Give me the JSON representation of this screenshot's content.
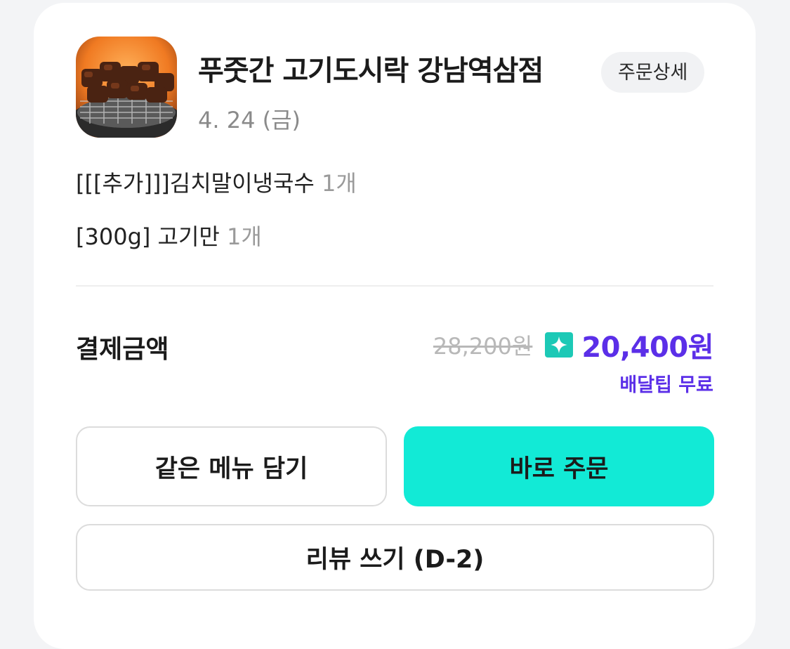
{
  "store": {
    "name": "푸줏간 고기도시락 강남역삼점",
    "order_detail_label": "주문상세",
    "date": "4. 24 (금)",
    "thumbnail_icon": "grilled-meat-photo"
  },
  "menu_items": [
    {
      "name": "[[[추가]]]김치말이냉국수",
      "quantity": "1개"
    },
    {
      "name": "[300g] 고기만",
      "quantity": "1개"
    }
  ],
  "payment": {
    "label": "결제금액",
    "original_price": "28,200원",
    "final_price": "20,400원",
    "delivery_tip": "배달팁 무료",
    "badge_icon": "sparkle-icon"
  },
  "actions": {
    "same_menu_label": "같은 메뉴 담기",
    "order_now_label": "바로 주문",
    "review_label": "리뷰 쓰기 (D-2)"
  },
  "colors": {
    "accent_mint": "#12ead6",
    "price_purple": "#5b2fe8",
    "badge_teal": "#1cc9b6"
  }
}
